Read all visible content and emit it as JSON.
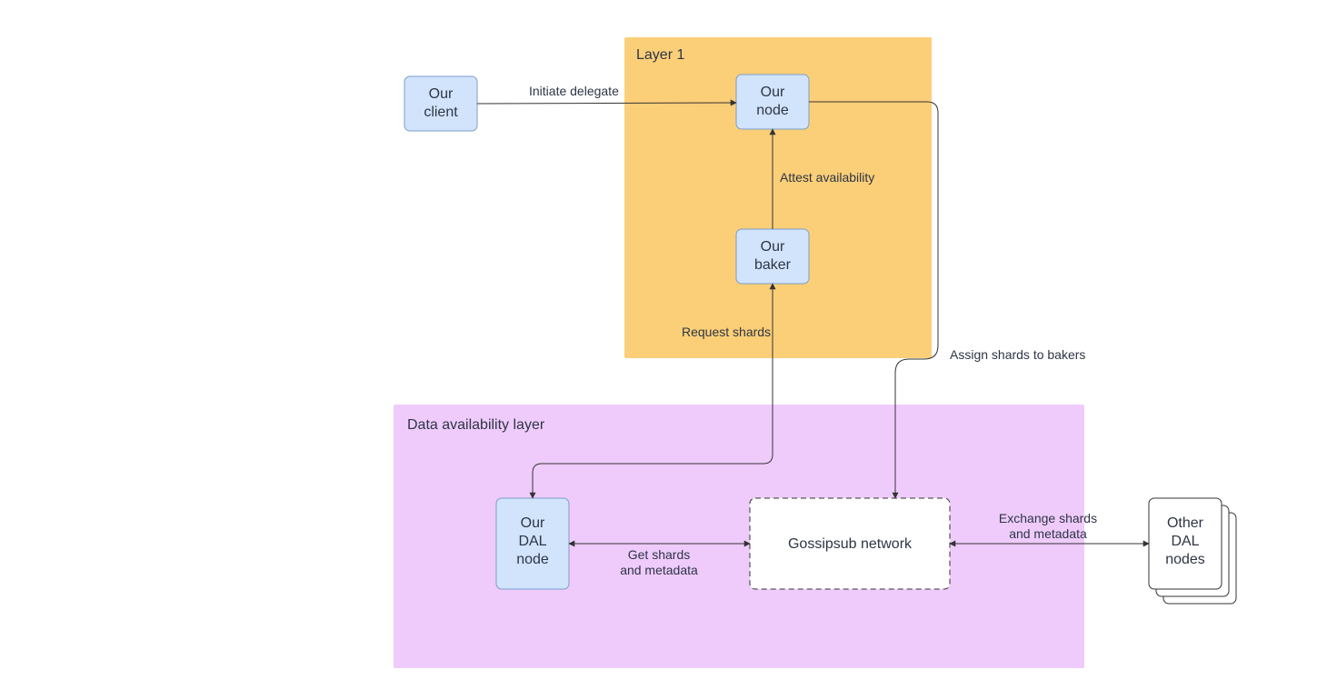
{
  "regions": {
    "layer1": {
      "label": "Layer 1"
    },
    "dal": {
      "label": "Data availability layer"
    }
  },
  "nodes": {
    "client": {
      "line1": "Our",
      "line2": "client"
    },
    "node": {
      "line1": "Our",
      "line2": "node"
    },
    "baker": {
      "line1": "Our",
      "line2": "baker"
    },
    "dalnode": {
      "line1": "Our",
      "line2": "DAL",
      "line3": "node"
    },
    "gossip": {
      "line1": "Gossipsub network"
    },
    "otherdal": {
      "line1": "Other",
      "line2": "DAL",
      "line3": "nodes"
    }
  },
  "edges": {
    "client_node": {
      "label": "Initiate delegate"
    },
    "baker_node": {
      "label": "Attest availability"
    },
    "dalnode_baker": {
      "label": "Request shards"
    },
    "node_gossip": {
      "label": "Assign shards to bakers"
    },
    "dalnode_gossip": {
      "line1": "Get shards",
      "line2": "and metadata"
    },
    "gossip_otherdal": {
      "line1": "Exchange shards",
      "line2": "and metadata"
    }
  }
}
